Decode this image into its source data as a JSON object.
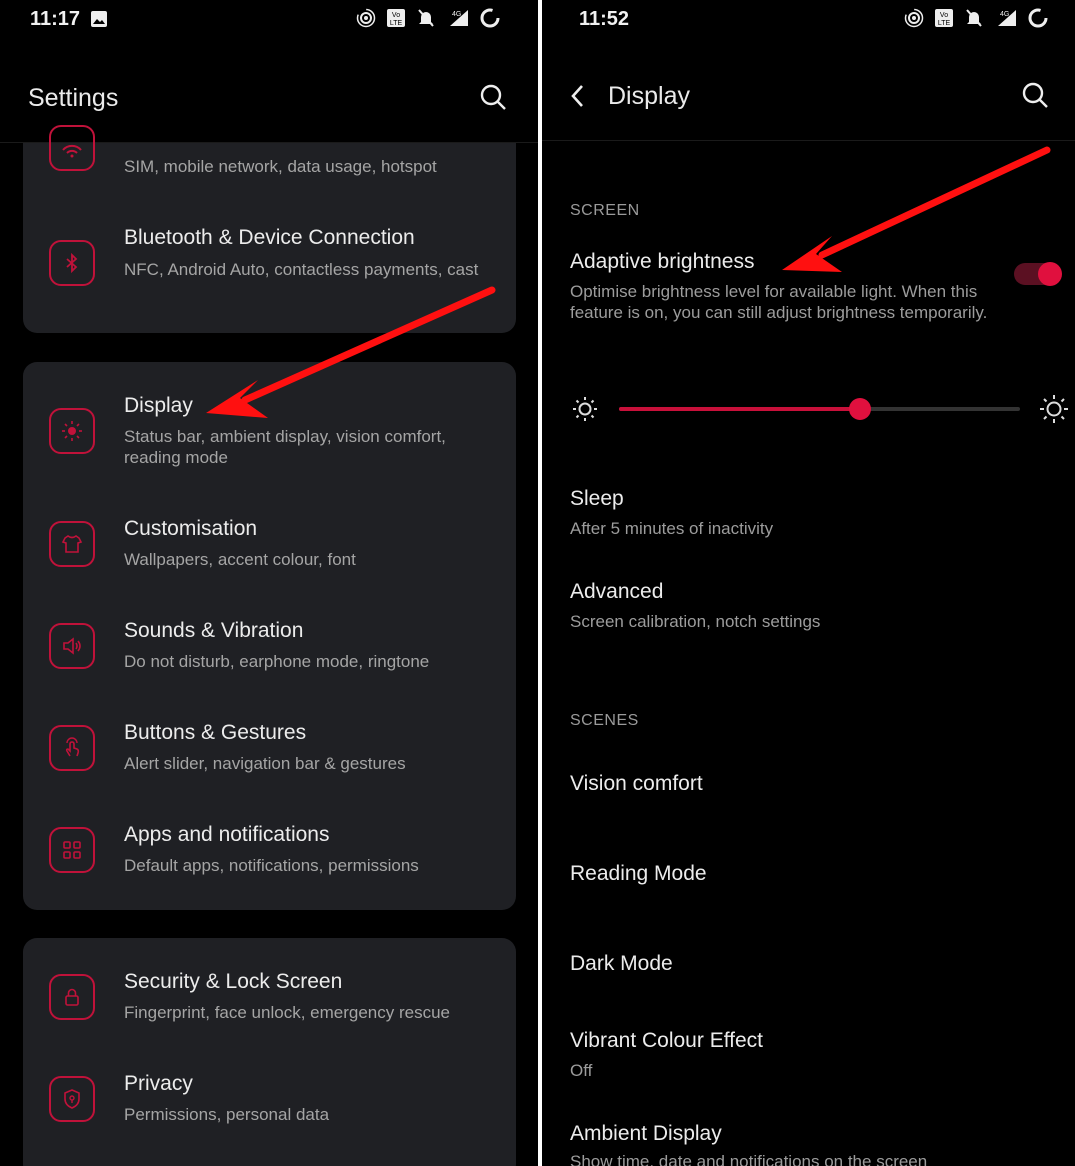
{
  "left": {
    "status": {
      "time": "11:17"
    },
    "header": {
      "title": "Settings"
    },
    "card1": {
      "items": [
        {
          "subtitle": "SIM, mobile network, data usage, hotspot",
          "icon": "wifi-icon"
        },
        {
          "title": "Bluetooth & Device Connection",
          "subtitle": "NFC, Android Auto, contactless payments, cast",
          "icon": "bluetooth-icon"
        }
      ]
    },
    "card2": {
      "items": [
        {
          "title": "Display",
          "subtitle": "Status bar, ambient display, vision comfort, reading mode",
          "icon": "brightness-icon"
        },
        {
          "title": "Customisation",
          "subtitle": "Wallpapers, accent colour, font",
          "icon": "tshirt-icon"
        },
        {
          "title": "Sounds & Vibration",
          "subtitle": "Do not disturb, earphone mode, ringtone",
          "icon": "speaker-icon"
        },
        {
          "title": "Buttons & Gestures",
          "subtitle": "Alert slider, navigation bar & gestures",
          "icon": "gesture-icon"
        },
        {
          "title": "Apps and notifications",
          "subtitle": "Default apps, notifications, permissions",
          "icon": "apps-grid-icon"
        }
      ]
    },
    "card3": {
      "items": [
        {
          "title": "Security & Lock Screen",
          "subtitle": "Fingerprint, face unlock, emergency rescue",
          "icon": "lock-icon"
        },
        {
          "title": "Privacy",
          "subtitle": "Permissions, personal data",
          "icon": "shield-icon"
        }
      ]
    }
  },
  "right": {
    "status": {
      "time": "11:52"
    },
    "header": {
      "title": "Display"
    },
    "section_screen": "SCREEN",
    "adaptive": {
      "title": "Adaptive brightness",
      "subtitle": "Optimise brightness level for available light. When this feature is on, you can still adjust brightness temporarily.",
      "enabled": true
    },
    "brightness_level": 0.6,
    "sleep": {
      "title": "Sleep",
      "subtitle": "After 5 minutes of inactivity"
    },
    "advanced": {
      "title": "Advanced",
      "subtitle": "Screen calibration, notch settings"
    },
    "section_scenes": "SCENES",
    "vision": {
      "title": "Vision comfort"
    },
    "reading": {
      "title": "Reading Mode"
    },
    "dark": {
      "title": "Dark Mode"
    },
    "vibrant": {
      "title": "Vibrant Colour Effect",
      "subtitle": "Off"
    },
    "ambient": {
      "title": "Ambient Display",
      "subtitle": "Show time, date and notifications on the screen"
    }
  },
  "colors": {
    "accent": "#e0103e",
    "card": "#1f2024",
    "background": "#000000",
    "arrow": "#ff1010"
  }
}
